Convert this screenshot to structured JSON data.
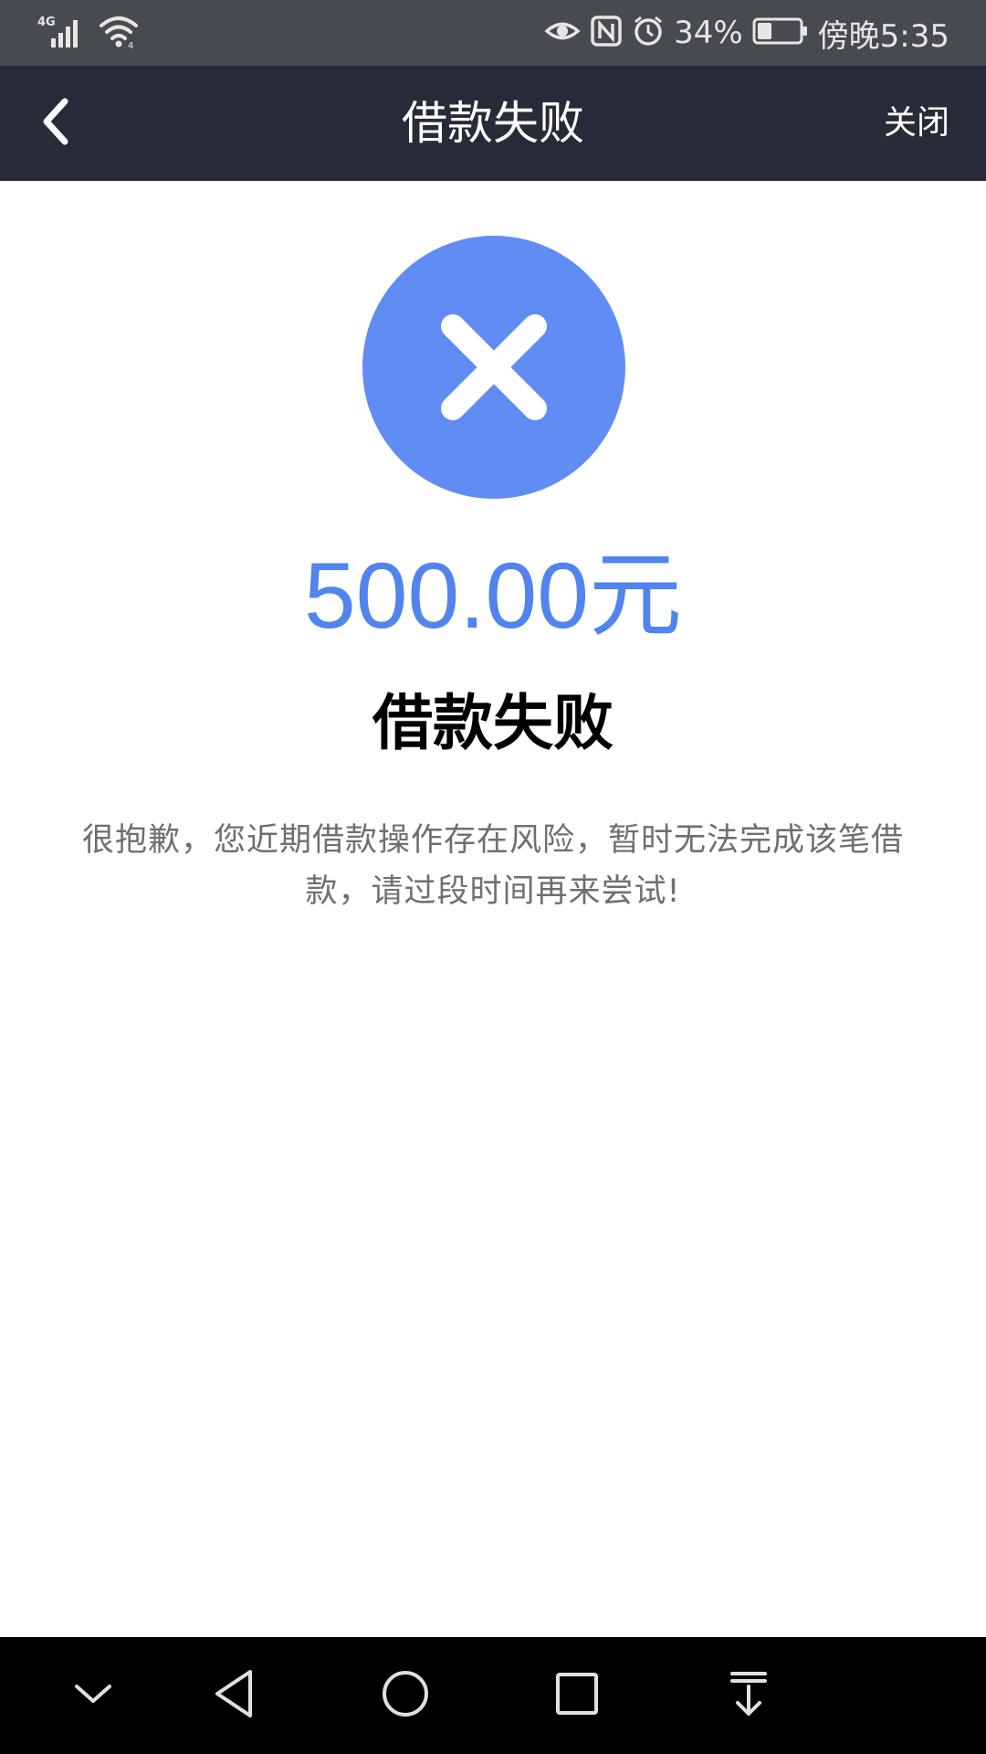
{
  "status_bar": {
    "network_label": "4G",
    "battery_percent": "34%",
    "time": "傍晚5:35",
    "icons": [
      "signal-icon",
      "wifi-icon",
      "eye-icon",
      "nfc-icon",
      "alarm-icon",
      "battery-icon"
    ],
    "battery_level": 0.34
  },
  "nav": {
    "title": "借款失败",
    "close_label": "关闭",
    "back_icon": "chevron-left-icon"
  },
  "result": {
    "icon": "close-circle-icon",
    "amount": "500.00元",
    "title": "借款失败",
    "description": "很抱歉，您近期借款操作存在风险，暂时无法完成该笔借款，请过段时间再来尝试!"
  },
  "system_nav": {
    "buttons": [
      "hide-nav-icon",
      "back-triangle-icon",
      "home-circle-icon",
      "recents-square-icon",
      "notifications-pull-icon"
    ]
  },
  "colors": {
    "status_bar_bg": "#474a4f",
    "nav_bar_bg": "#272a37",
    "accent_blue": "#608cf4",
    "amount_blue": "#5184ec",
    "description_gray": "#6f6f6f",
    "system_nav_bg": "#000000"
  }
}
